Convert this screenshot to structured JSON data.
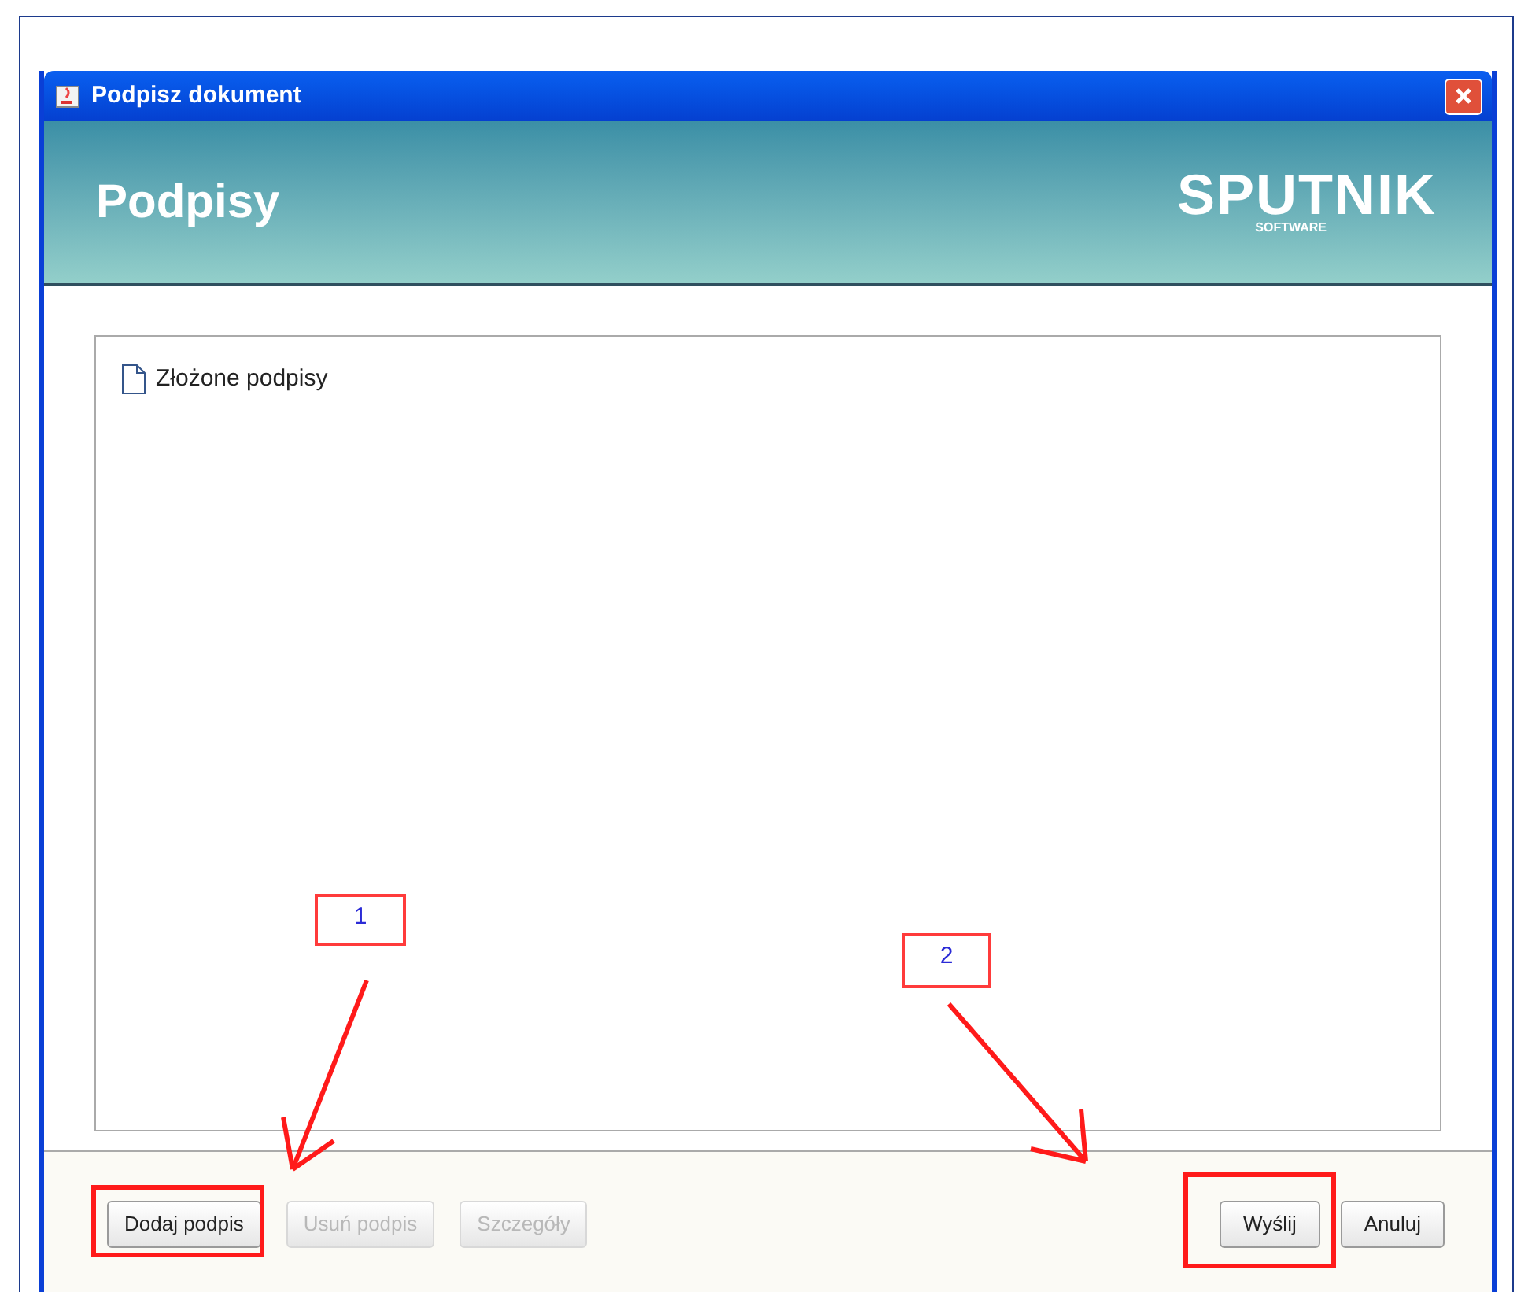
{
  "window": {
    "title": "Podpisz dokument"
  },
  "header": {
    "title": "Podpisy",
    "logo": "SPUTNIK",
    "logo_sub": "SOFTWARE"
  },
  "tree": {
    "items": [
      {
        "label": "Złożone podpisy"
      }
    ]
  },
  "buttons_left": [
    {
      "label": "Dodaj podpis",
      "disabled": false,
      "highlighted": true
    },
    {
      "label": "Usuń podpis",
      "disabled": true,
      "highlighted": false
    },
    {
      "label": "Szczegóły",
      "disabled": true,
      "highlighted": false
    }
  ],
  "buttons_right": [
    {
      "label": "Wyślij",
      "disabled": false,
      "highlighted": true
    },
    {
      "label": "Anuluj",
      "disabled": false,
      "highlighted": false
    }
  ],
  "annotations": [
    {
      "label": "1"
    },
    {
      "label": "2"
    }
  ]
}
